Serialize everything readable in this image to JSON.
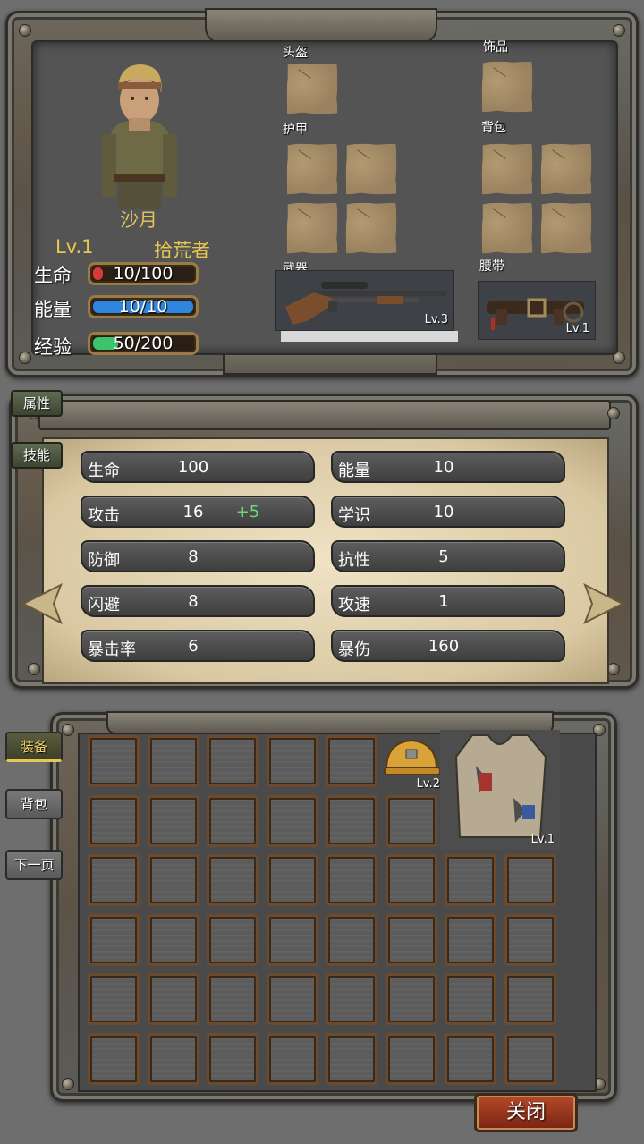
{
  "character": {
    "name": "沙月",
    "level": "Lv.1",
    "class": "拾荒者",
    "stats": [
      {
        "label": "生命",
        "text": "10/100",
        "fill": 0.1,
        "color": "#d83a3a"
      },
      {
        "label": "能量",
        "text": "10/10",
        "fill": 1.0,
        "color": "#2f86e0"
      },
      {
        "label": "经验",
        "text": "50/200",
        "fill": 0.25,
        "color": "#3dc46a"
      }
    ]
  },
  "equip_slots": {
    "helmet": "头盔",
    "accessory": "饰品",
    "armor": "护甲",
    "backpack": "背包",
    "weapon": "武器",
    "belt": "腰带"
  },
  "equipped": {
    "weapon_level": "Lv.3",
    "belt_level": "Lv.1"
  },
  "attr_tabs": [
    "属性",
    "技能"
  ],
  "attributes": [
    {
      "name": "生命",
      "value": "100",
      "bonus": ""
    },
    {
      "name": "能量",
      "value": "10",
      "bonus": ""
    },
    {
      "name": "攻击",
      "value": "16",
      "bonus": "+5"
    },
    {
      "name": "学识",
      "value": "10",
      "bonus": ""
    },
    {
      "name": "防御",
      "value": "8",
      "bonus": ""
    },
    {
      "name": "抗性",
      "value": "5",
      "bonus": ""
    },
    {
      "name": "闪避",
      "value": "8",
      "bonus": ""
    },
    {
      "name": "攻速",
      "value": "1",
      "bonus": ""
    },
    {
      "name": "暴击率",
      "value": "6",
      "bonus": ""
    },
    {
      "name": "暴伤",
      "value": "160",
      "bonus": ""
    }
  ],
  "inventory": {
    "tabs": [
      "装备",
      "背包",
      "下一页"
    ],
    "items": [
      {
        "name": "helmet",
        "level": "Lv.2"
      },
      {
        "name": "vest",
        "level": "Lv.1"
      }
    ]
  },
  "close_label": "关闭",
  "colors": {
    "bonus_green": "#6fd77a",
    "title_gold": "#e8c850"
  }
}
